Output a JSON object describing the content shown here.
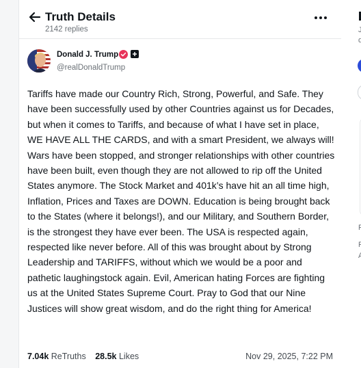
{
  "header": {
    "title": "Truth Details",
    "replies": "2142 replies"
  },
  "post": {
    "author_name": "Donald J. Trump",
    "handle": "@realDonaldTrump",
    "body": "Tariffs have made our Country Rich, Strong, Powerful, and Safe. They have been successfully used by other Countries against us for Decades, but when it comes to Tariffs, and because of what I have set in place, WE HAVE ALL THE CARDS, and with a smart President, we always will! Wars have been stopped, and stronger relationships with other countries have been built, even though they are not allowed to rip off the United States anymore. The Stock Market and 401k’s have hit an all time high, Inflation, Prices and Taxes are DOWN. Education is being brought back to the States (where it belongs!), and our Military, and Southern Border, is the strongest they have ever been. The USA is respected again, respected like never before. All of this was brought about by Strong Leadership and TARIFFS, without which we would be a poor and pathetic laughingstock again. Evil, American hating Forces are fighting us at the United States Supreme Court. Pray to God that our Nine Justices will show great wisdom, and do the right thing for America!",
    "retruths_count": "7.04k",
    "retruths_label": "ReTruths",
    "likes_count": "28.5k",
    "likes_label": "Likes",
    "timestamp": "Nov 29, 2025, 7:22 PM"
  },
  "right_column": {
    "fragments": [
      "J",
      "d",
      "F",
      "F",
      "A"
    ]
  },
  "colors": {
    "verified": "#e8345a",
    "accent": "#2b4bd9",
    "muted_text": "#6b7177"
  },
  "icons": {
    "back": "arrow-left-icon",
    "more": "ellipsis-horizontal-icon",
    "verified": "verified-badge-icon",
    "plus": "plus-square-icon"
  }
}
